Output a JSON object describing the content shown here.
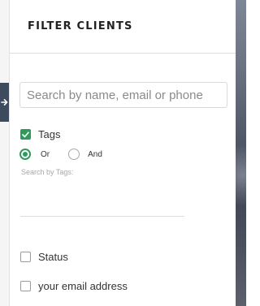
{
  "panel": {
    "title": "FILTER CLIENTS"
  },
  "search": {
    "placeholder": "Search by name, email or phone",
    "value": ""
  },
  "tags": {
    "label": "Tags",
    "checked": true,
    "match_options": [
      {
        "label": "Or",
        "selected": true
      },
      {
        "label": "And",
        "selected": false
      }
    ],
    "hint": "Search by Tags:"
  },
  "filters": [
    {
      "label": "Status",
      "checked": false
    },
    {
      "label": "your email address",
      "checked": false
    }
  ],
  "icons": {
    "toggle": "arrow-right-icon",
    "check": "checkmark-icon"
  },
  "colors": {
    "accent": "#2f9a5c",
    "tab": "#3e4a5e"
  }
}
